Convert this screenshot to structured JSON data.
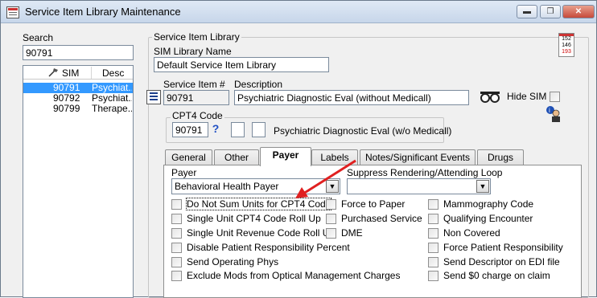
{
  "window": {
    "title": "Service Item Library Maintenance",
    "minimize": "▬",
    "restore": "❐",
    "close": "✕"
  },
  "search": {
    "label": "Search",
    "value": "90791"
  },
  "list": {
    "col_sim": "SIM",
    "col_desc": "Desc",
    "rows": [
      {
        "sim": "90791",
        "desc": "Psychiat..."
      },
      {
        "sim": "90792",
        "desc": "Psychiat..."
      },
      {
        "sim": "90799",
        "desc": "Therape..."
      }
    ]
  },
  "library": {
    "group_label": "Service Item Library",
    "name_label": "SIM Library Name",
    "name_value": "Default Service Item Library"
  },
  "calendar_icon": {
    "lines": [
      "152",
      "146",
      "193"
    ]
  },
  "service_item": {
    "number_label": "Service Item #",
    "number_value": "90791",
    "description_label": "Description",
    "description_value": "Psychiatric Diagnostic Eval (without Medicall)",
    "hide_sim_label": "Hide SIM"
  },
  "cpt4": {
    "label": "CPT4 Code",
    "value": "90791",
    "help": "?",
    "description": "Psychiatric Diagnostic Eval (w/o Medicall)"
  },
  "tabs": [
    "General",
    "Other",
    "Payer",
    "Labels",
    "Notes/Significant Events",
    "Drugs"
  ],
  "payer_tab": {
    "payer_label": "Payer",
    "payer_value": "Behavioral Health Payer",
    "suppress_label": "Suppress Rendering/Attending Loop",
    "suppress_value": "",
    "col1": [
      "Do Not Sum Units for CPT4 Code",
      "Single Unit CPT4 Code Roll Up",
      "Single Unit Revenue Code Roll Up",
      "Disable Patient Responsibility Percent",
      "Send Operating Phys",
      "Exclude Mods from Optical Management Charges"
    ],
    "col2": [
      "Force to Paper",
      "Purchased Service",
      "DME"
    ],
    "col3": [
      "Mammography Code",
      "Qualifying Encounter",
      "Non Covered",
      "Force Patient Responsibility",
      "Send Descriptor on EDI file",
      "Send $0 charge on claim"
    ]
  },
  "colors": {
    "annotation_arrow": "#e02020",
    "selection": "#3399ff"
  }
}
